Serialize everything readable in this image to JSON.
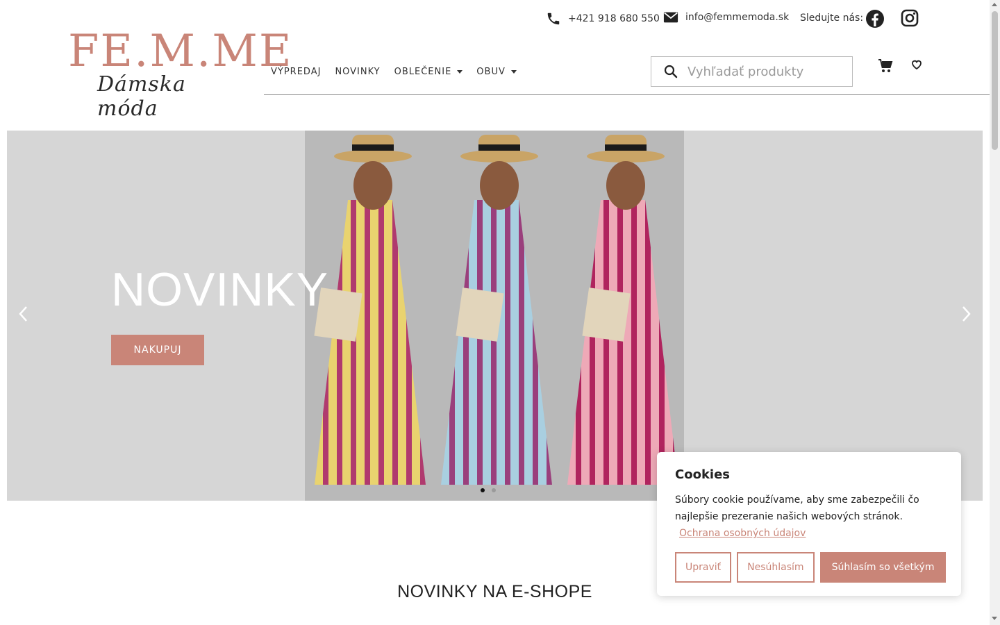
{
  "topbar": {
    "phone": "+421 918 680 550",
    "email": "info@femmemoda.sk",
    "follow_label": "Sledujte nás:"
  },
  "logo": {
    "main": "FE.M.ME",
    "sub": "Dámska móda"
  },
  "nav": {
    "items": [
      {
        "label": "VÝPREDAJ",
        "dropdown": false
      },
      {
        "label": "NOVINKY",
        "dropdown": false
      },
      {
        "label": "OBLEČENIE",
        "dropdown": true
      },
      {
        "label": "OBUV",
        "dropdown": true
      }
    ]
  },
  "search": {
    "placeholder": "Vyhľadať produkty"
  },
  "hero": {
    "title": "NOVINKY",
    "button": "NAKUPUJ",
    "slides_total": 2,
    "active_slide": 1
  },
  "section": {
    "title": "NOVINKY NA E-SHOPE"
  },
  "cookie": {
    "title": "Cookies",
    "text": "Súbory cookie používame, aby sme zabezpečili čo najlepšie prezeranie našich webových stránok.",
    "link": "Ochrana osobných údajov",
    "btn_edit": "Upraviť",
    "btn_decline": "Nesúhlasím",
    "btn_accept": "Súhlasím so všetkým"
  },
  "colors": {
    "brand": "#c98578",
    "hero_bg": "#d6d6d6",
    "dress_yellow": "#e9d36f",
    "dress_blue": "#a9cfe0",
    "dress_pink": "#eea9b7",
    "stripe": "#b03a6e"
  },
  "icons": [
    "phone-icon",
    "mail-icon",
    "facebook-icon",
    "instagram-icon",
    "search-icon",
    "cart-icon",
    "heart-icon",
    "chevron-left-icon",
    "chevron-right-icon",
    "caret-down-icon"
  ]
}
